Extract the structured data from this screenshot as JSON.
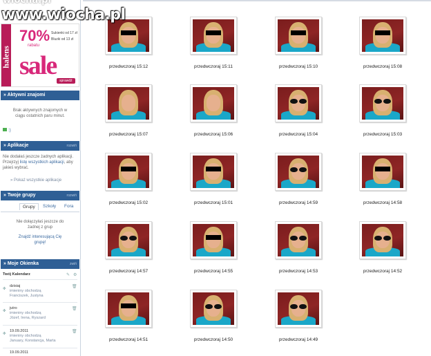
{
  "watermark": {
    "top": "wiocha.pl",
    "main": "www.wiocha.pl"
  },
  "ad": {
    "brand": "halens",
    "percent": "70%",
    "subtitle": "rabatu",
    "line1": "Sukienki od 17 zł",
    "line2": "Bluzki od 13 zł",
    "headline": "sale",
    "button": "sprawdź"
  },
  "friends": {
    "title": "Aktywni znajomi",
    "empty": "Brak aktywnych znajomych w ciągu ostatnich paru minut.",
    "status": ":)"
  },
  "apps": {
    "title": "Aplikacje",
    "action": "rozwiń",
    "text1": "Nie dodałaś jeszcze żadnych aplikacji. Przejrzyj",
    "link1": "listę wszystkich aplikacji",
    "text2": ", aby jakieś wybrać.",
    "show_all": "Pokaż wszystkie aplikacje"
  },
  "groups": {
    "title": "Twoje grupy",
    "action": "rozwiń",
    "tabs": [
      "Grupy",
      "Szkoły",
      "Fora"
    ],
    "empty": "Nie dołączyłaś jeszcze do żadnej z grup",
    "find": "Znajdź interesującą Cię grupę!"
  },
  "windows": {
    "title": "Moje Okienka",
    "action": "zwiń",
    "calendar": "Twój Kalendarz",
    "events": [
      {
        "date": "dzisiaj",
        "type": "imieniny obchodzą",
        "names": "Franciszek, Justyna"
      },
      {
        "date": "jutro",
        "type": "imieniny obchodzą",
        "names": "Józef, Irena, Ryszard"
      },
      {
        "date": "19.09.2011",
        "type": "imieniny obchodzą",
        "names": "January, Konstancja, Marta"
      },
      {
        "date": "19.09.2011",
        "type": "",
        "names": ""
      }
    ]
  },
  "photos": [
    {
      "caption": "przedwczoraj 15:12",
      "style": "bar"
    },
    {
      "caption": "przedwczoraj 15:11",
      "style": "bar"
    },
    {
      "caption": "przedwczoraj 15:10",
      "style": "bar"
    },
    {
      "caption": "przedwczoraj 15:08",
      "style": "bar"
    },
    {
      "caption": "przedwczoraj 15:07",
      "style": "plain"
    },
    {
      "caption": "przedwczoraj 15:06",
      "style": "plain"
    },
    {
      "caption": "przedwczoraj 15:04",
      "style": "glasses"
    },
    {
      "caption": "przedwczoraj 15:03",
      "style": "glasses"
    },
    {
      "caption": "przedwczoraj 15:02",
      "style": "bar"
    },
    {
      "caption": "przedwczoraj 15:01",
      "style": "bar"
    },
    {
      "caption": "przedwczoraj 14:59",
      "style": "glasses"
    },
    {
      "caption": "przedwczoraj 14:58",
      "style": "bar"
    },
    {
      "caption": "przedwczoraj 14:57",
      "style": "glasses"
    },
    {
      "caption": "przedwczoraj 14:55",
      "style": "bar"
    },
    {
      "caption": "przedwczoraj 14:53",
      "style": "glasses"
    },
    {
      "caption": "przedwczoraj 14:52",
      "style": "glasses"
    },
    {
      "caption": "przedwczoraj 14:51",
      "style": "bar"
    },
    {
      "caption": "przedwczoraj 14:50",
      "style": "glasses"
    },
    {
      "caption": "przedwczoraj 14:49",
      "style": "glasses"
    }
  ]
}
